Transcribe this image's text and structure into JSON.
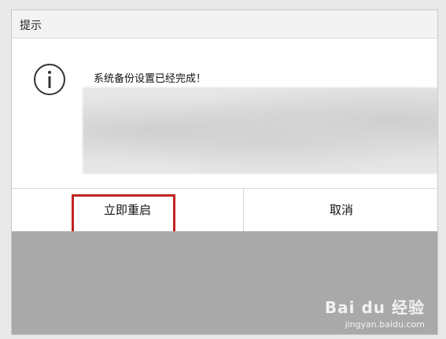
{
  "dialog": {
    "title": "提示",
    "icon": "info-circle-icon",
    "message": "系统备份设置已经完成！",
    "buttons": {
      "restart_label": "立即重启",
      "cancel_label": "取消"
    }
  },
  "watermark": {
    "brand": "Bai du 经验",
    "url": "jingyan.baidu.com"
  },
  "colors": {
    "highlight": "#c22323",
    "dialog_bg": "#ffffff",
    "overlay": "#a9a9a9"
  }
}
